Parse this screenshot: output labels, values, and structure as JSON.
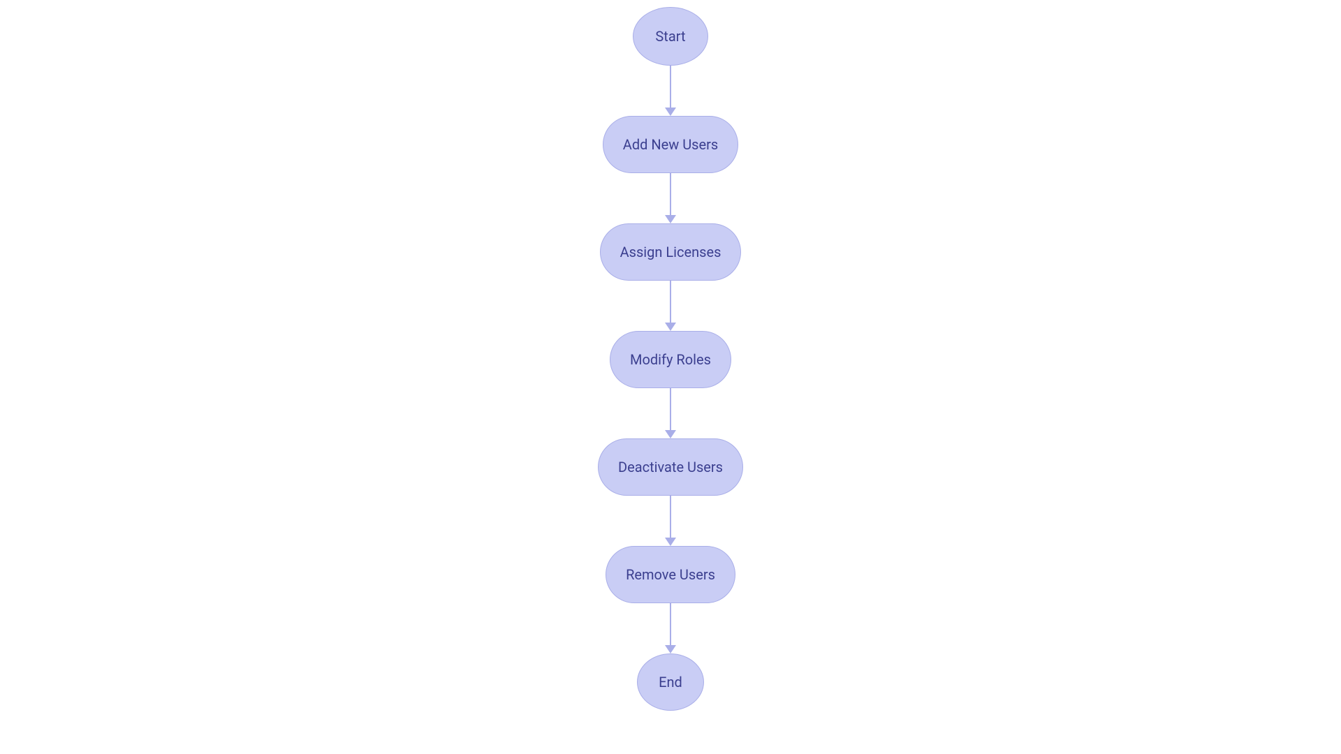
{
  "flowchart": {
    "nodes": [
      {
        "id": "start",
        "label": "Start",
        "type": "terminal"
      },
      {
        "id": "add-users",
        "label": "Add New Users",
        "type": "process"
      },
      {
        "id": "assign-licenses",
        "label": "Assign Licenses",
        "type": "process"
      },
      {
        "id": "modify-roles",
        "label": "Modify Roles",
        "type": "process"
      },
      {
        "id": "deactivate-users",
        "label": "Deactivate Users",
        "type": "process"
      },
      {
        "id": "remove-users",
        "label": "Remove Users",
        "type": "process"
      },
      {
        "id": "end",
        "label": "End",
        "type": "terminal-small"
      }
    ],
    "colors": {
      "node_fill": "#c9cdf5",
      "node_border": "#a9aee8",
      "node_text": "#3b3f8f",
      "connector": "#a9aee8"
    }
  }
}
